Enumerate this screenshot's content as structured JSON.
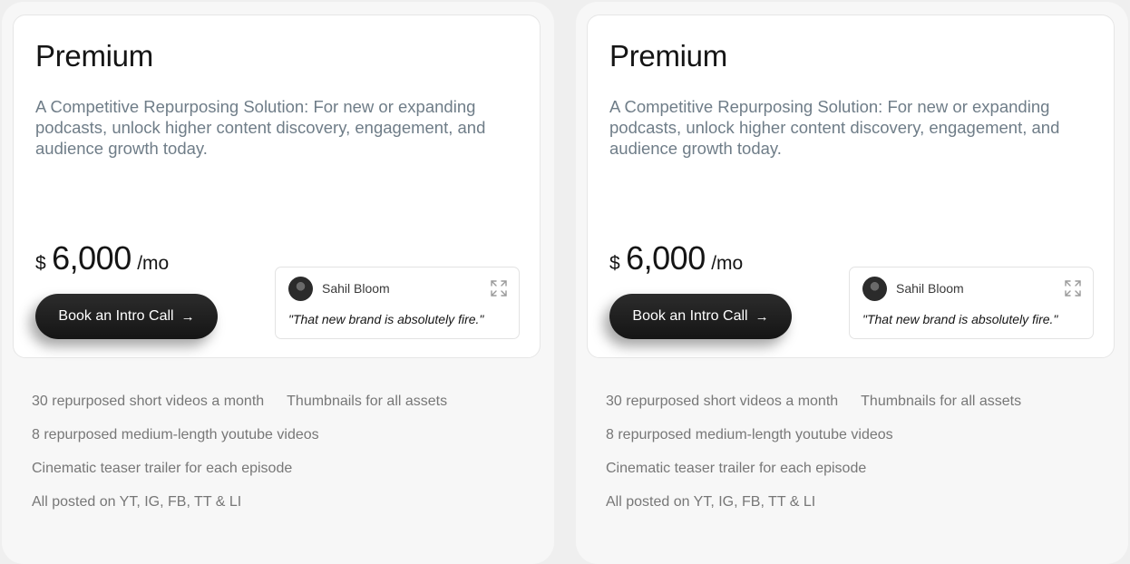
{
  "plans": [
    {
      "title": "Premium",
      "description": "A Competitive Repurposing Solution: For new or expanding podcasts, unlock higher content discovery, engagement, and audience growth today.",
      "currency": "$",
      "price": "6,000",
      "period": "/mo",
      "cta_label": "Book an Intro Call",
      "testimonial": {
        "author": "Sahil Bloom",
        "quote": "\"That new brand is absolutely fire.\""
      },
      "features": [
        "30 repurposed short videos a month",
        "Thumbnails for all assets",
        "8 repurposed medium-length youtube videos",
        "Cinematic teaser trailer for each episode",
        "All posted on YT, IG, FB, TT & LI"
      ]
    },
    {
      "title": "Premium",
      "description": "A Competitive Repurposing Solution: For new or expanding podcasts, unlock higher content discovery, engagement, and audience growth today.",
      "currency": "$",
      "price": "6,000",
      "period": "/mo",
      "cta_label": "Book an Intro Call",
      "testimonial": {
        "author": "Sahil Bloom",
        "quote": "\"That new brand is absolutely fire.\""
      },
      "features": [
        "30 repurposed short videos a month",
        "Thumbnails for all assets",
        "8 repurposed medium-length youtube videos",
        "Cinematic teaser trailer for each episode",
        "All posted on YT, IG, FB, TT & LI"
      ]
    }
  ],
  "icons": {
    "cta_arrow": "arrow-right-icon",
    "testimonial_expand": "expand-icon"
  }
}
